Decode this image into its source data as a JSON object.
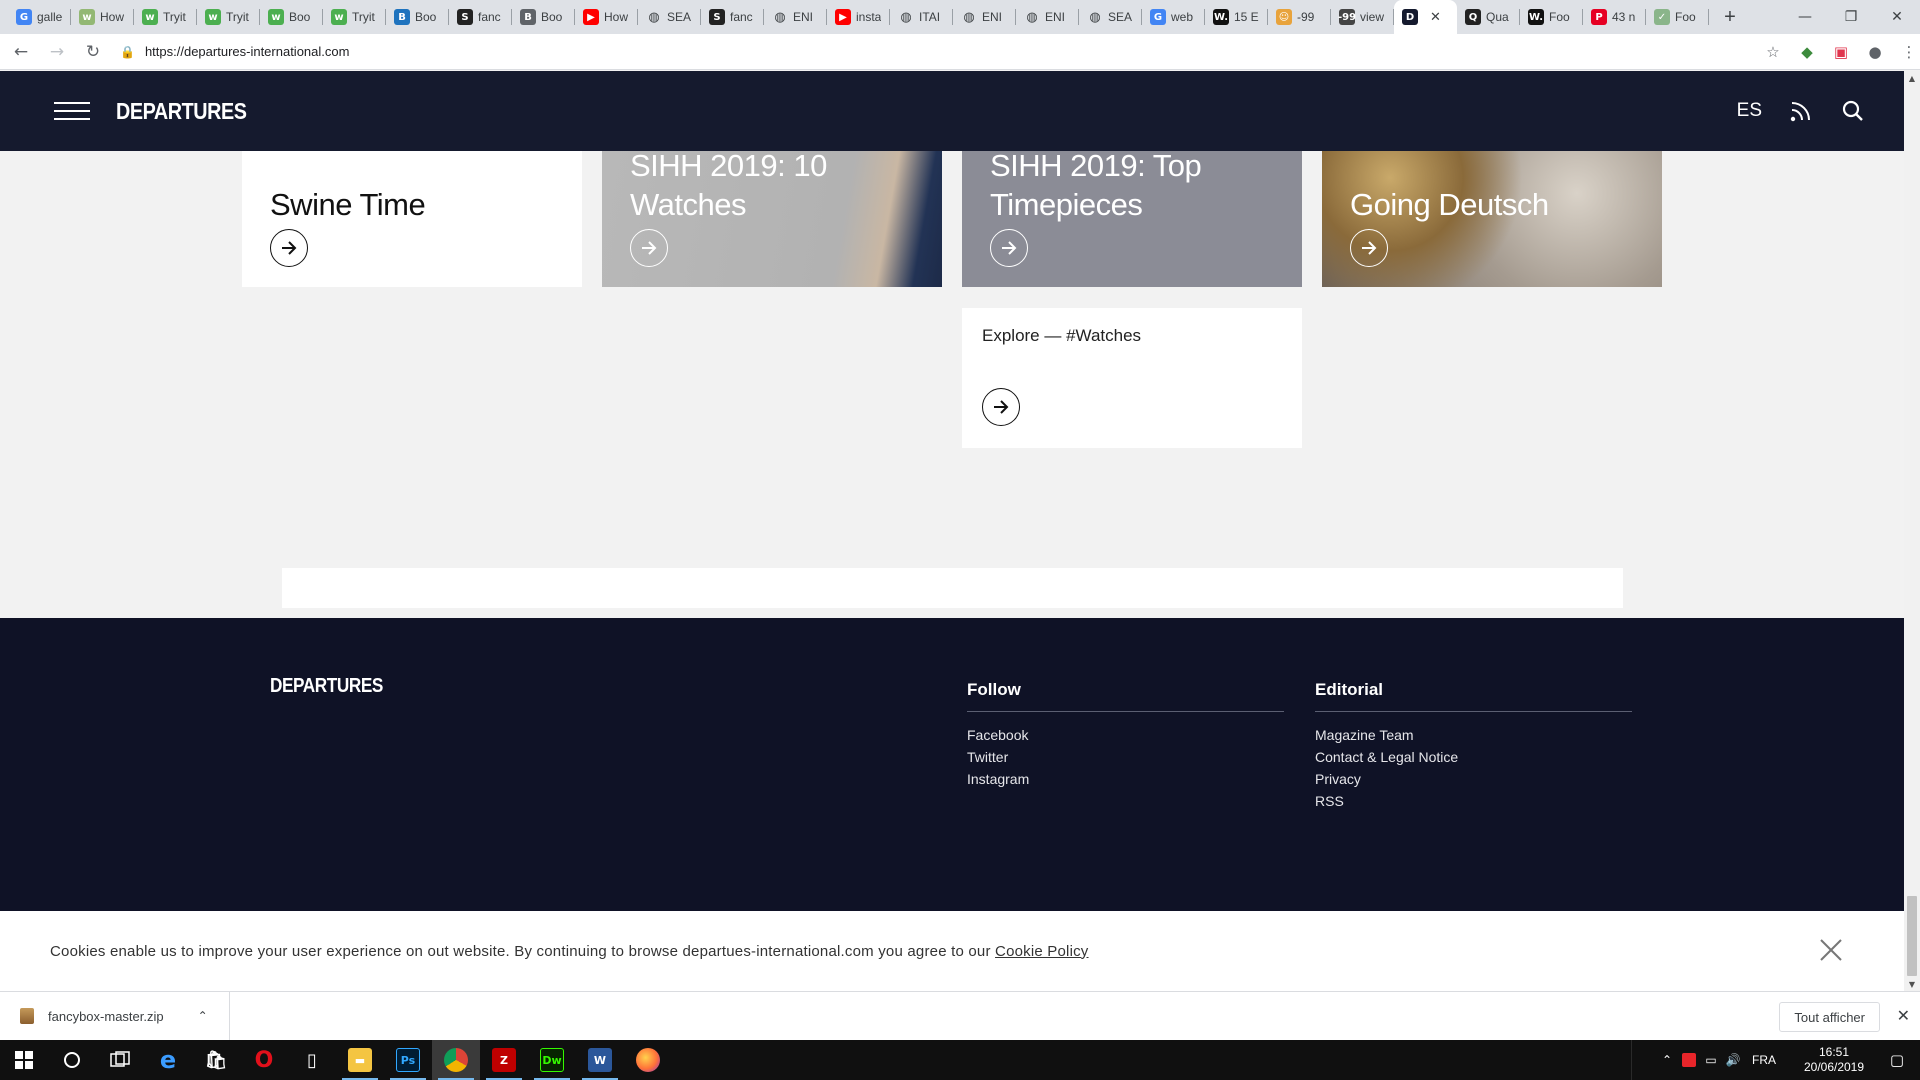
{
  "browser": {
    "tabs": [
      {
        "title": "galle",
        "favicon": "google-icon",
        "color": "#4285f4",
        "glyph": "G"
      },
      {
        "title": "How",
        "favicon": "wikihow-icon",
        "color": "#93b874",
        "glyph": "w"
      },
      {
        "title": "Tryit",
        "favicon": "w3schools-icon",
        "color": "#4caf50",
        "glyph": "w"
      },
      {
        "title": "Tryit",
        "favicon": "w3schools-icon",
        "color": "#4caf50",
        "glyph": "w"
      },
      {
        "title": "Boo",
        "favicon": "w3schools-icon",
        "color": "#4caf50",
        "glyph": "w"
      },
      {
        "title": "Tryit",
        "favicon": "w3schools-icon",
        "color": "#4caf50",
        "glyph": "w"
      },
      {
        "title": "Boo",
        "favicon": "bootstrap-icon",
        "color": "#1e73be",
        "glyph": "B"
      },
      {
        "title": "fanc",
        "favicon": "stackoverflow-icon",
        "color": "#222222",
        "glyph": "S"
      },
      {
        "title": "Boo",
        "favicon": "page-icon",
        "color": "#5f6368",
        "glyph": "B"
      },
      {
        "title": "How",
        "favicon": "youtube-icon",
        "color": "#ff0000",
        "glyph": "▶"
      },
      {
        "title": "SEA",
        "favicon": "globe-icon",
        "color": "#3c4043",
        "glyph": "◍"
      },
      {
        "title": "fanc",
        "favicon": "stackoverflow-icon",
        "color": "#222222",
        "glyph": "S"
      },
      {
        "title": "ENI",
        "favicon": "globe-icon",
        "color": "#3c4043",
        "glyph": "◍"
      },
      {
        "title": "insta",
        "favicon": "youtube-icon",
        "color": "#ff0000",
        "glyph": "▶"
      },
      {
        "title": "ITAI",
        "favicon": "globe-icon",
        "color": "#3c4043",
        "glyph": "◍"
      },
      {
        "title": "ENI",
        "favicon": "globe-icon",
        "color": "#3c4043",
        "glyph": "◍"
      },
      {
        "title": "ENI",
        "favicon": "globe-icon",
        "color": "#3c4043",
        "glyph": "◍"
      },
      {
        "title": "SEA",
        "favicon": "globe-icon",
        "color": "#3c4043",
        "glyph": "◍"
      },
      {
        "title": "web",
        "favicon": "google-icon",
        "color": "#4285f4",
        "glyph": "G"
      },
      {
        "title": "15 E",
        "favicon": "wix-icon",
        "color": "#111111",
        "glyph": "W."
      },
      {
        "title": "-99",
        "favicon": "emoji-icon",
        "color": "#e8a33c",
        "glyph": "☺"
      },
      {
        "title": "view",
        "favicon": "counter-icon",
        "color": "#444444",
        "glyph": "-99"
      },
      {
        "title": "",
        "favicon": "departures-icon",
        "color": "#151a2e",
        "glyph": "D",
        "active": true
      },
      {
        "title": "Qua",
        "favicon": "quora-icon",
        "color": "#222222",
        "glyph": "Q"
      },
      {
        "title": "Foo",
        "favicon": "wix-icon",
        "color": "#111111",
        "glyph": "W."
      },
      {
        "title": "43 n",
        "favicon": "pinterest-icon",
        "color": "#e60023",
        "glyph": "P"
      },
      {
        "title": "Foo",
        "favicon": "check-icon",
        "color": "#8ab58a",
        "glyph": "✓"
      }
    ],
    "url": "https://departures-international.com"
  },
  "header": {
    "logo": "DEPARTURES",
    "language": "ES"
  },
  "cards": [
    {
      "title": "Swine Time",
      "bg": "#ffffff",
      "fg": "#111111",
      "variant": "plain"
    },
    {
      "title": "SIHH 2019: 10 Watches",
      "bg": "#b0b0b0",
      "fg": "#ffffff",
      "variant": "watch"
    },
    {
      "title": "SIHH 2019: Top Timepieces",
      "bg": "#8b8c96",
      "fg": "#ffffff",
      "variant": "grey"
    },
    {
      "title": "Going Deutsch",
      "bg": "#a08f80",
      "fg": "#ffffff",
      "variant": "photo"
    }
  ],
  "explore": {
    "label": "Explore — #Watches"
  },
  "footer": {
    "logo": "DEPARTURES",
    "columns": [
      {
        "heading": "Follow",
        "links": [
          "Facebook",
          "Twitter",
          "Instagram"
        ]
      },
      {
        "heading": "Editorial",
        "links": [
          "Magazine Team",
          "Contact & Legal Notice",
          "Privacy",
          "RSS"
        ]
      }
    ]
  },
  "cookie": {
    "text": "Cookies enable us to improve your user experience on out website. By continuing to browse departues-international.com you agree to our ",
    "link": "Cookie Policy"
  },
  "downloads": {
    "file": "fancybox-master.zip",
    "show_all": "Tout afficher"
  },
  "taskbar": {
    "apps": [
      {
        "name": "edge-icon",
        "color": "#1e78d7",
        "glyph": "e",
        "open": false
      },
      {
        "name": "store-icon",
        "color": "#ffffff",
        "glyph": "🛍",
        "open": false
      },
      {
        "name": "opera-icon",
        "color": "#e2101b",
        "glyph": "O",
        "open": false
      },
      {
        "name": "file-icon",
        "color": "#ffffff",
        "glyph": "▯",
        "open": false
      },
      {
        "name": "file-explorer-icon",
        "color": "#f4c542",
        "glyph": "▬",
        "open": true
      },
      {
        "name": "photoshop-icon",
        "color": "#001d34",
        "glyph": "Ps",
        "open": true
      },
      {
        "name": "chrome-icon",
        "color": "#db4437",
        "glyph": "◉",
        "open": true,
        "active": true
      },
      {
        "name": "filezilla-icon",
        "color": "#bf0000",
        "glyph": "Z",
        "open": true
      },
      {
        "name": "dreamweaver-icon",
        "color": "#35fa00",
        "glyph": "Dw",
        "open": true
      },
      {
        "name": "word-icon",
        "color": "#2b579a",
        "glyph": "W",
        "open": true
      },
      {
        "name": "firefox-icon",
        "color": "#ff7139",
        "glyph": "◕",
        "open": false
      }
    ],
    "language": "FRA",
    "time": "16:51",
    "date": "20/06/2019"
  }
}
